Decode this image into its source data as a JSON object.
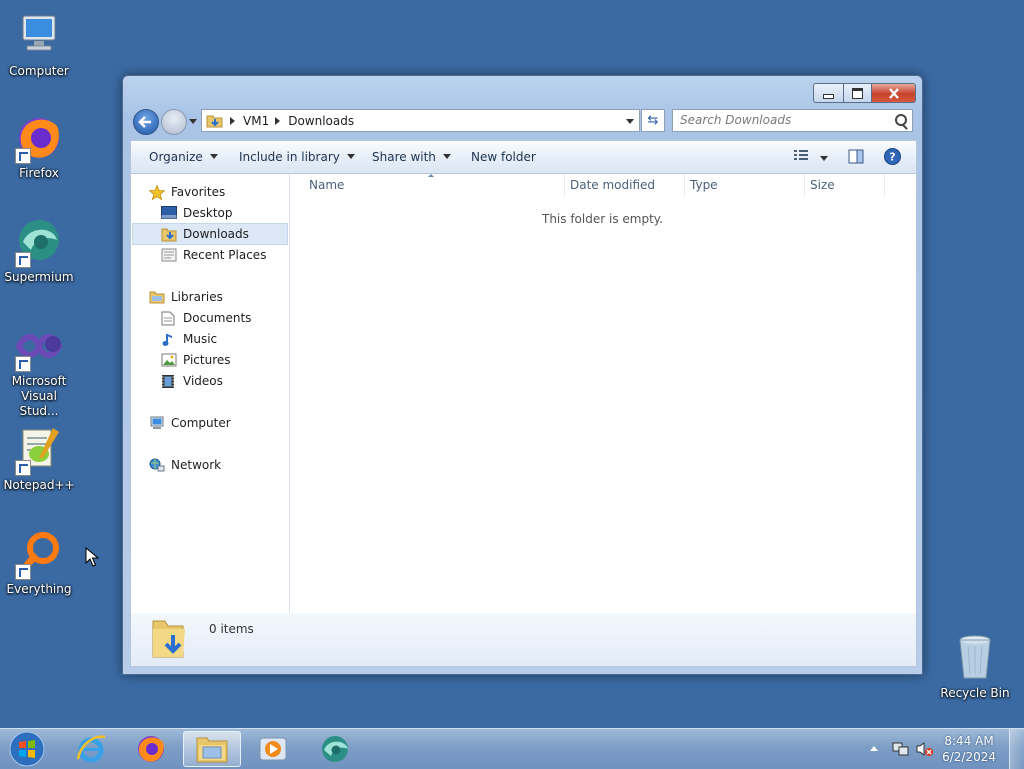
{
  "desktop": {
    "icons": [
      {
        "label": "Computer"
      },
      {
        "label": "Firefox"
      },
      {
        "label": "Supermium"
      },
      {
        "label": "Microsoft Visual Stud..."
      },
      {
        "label": "Notepad++"
      },
      {
        "label": "Everything"
      },
      {
        "label": "Recycle Bin"
      }
    ]
  },
  "explorer": {
    "breadcrumb": [
      "VM1",
      "Downloads"
    ],
    "search_placeholder": "Search Downloads",
    "toolbar": {
      "organize": "Organize",
      "include_in_library": "Include in library",
      "share_with": "Share with",
      "new_folder": "New folder"
    },
    "nav": {
      "favorites": "Favorites",
      "desktop": "Desktop",
      "downloads": "Downloads",
      "recent_places": "Recent Places",
      "libraries": "Libraries",
      "documents": "Documents",
      "music": "Music",
      "pictures": "Pictures",
      "videos": "Videos",
      "computer": "Computer",
      "network": "Network"
    },
    "columns": [
      "Name",
      "Date modified",
      "Type",
      "Size"
    ],
    "empty_message": "This folder is empty.",
    "details_count": "0 items"
  },
  "taskbar": {
    "time": "8:44 AM",
    "date": "6/2/2024"
  },
  "colors": {
    "desktop_bg": "#3b6aa3",
    "selection": "#dde8f6",
    "close_button": "#c7432e"
  }
}
